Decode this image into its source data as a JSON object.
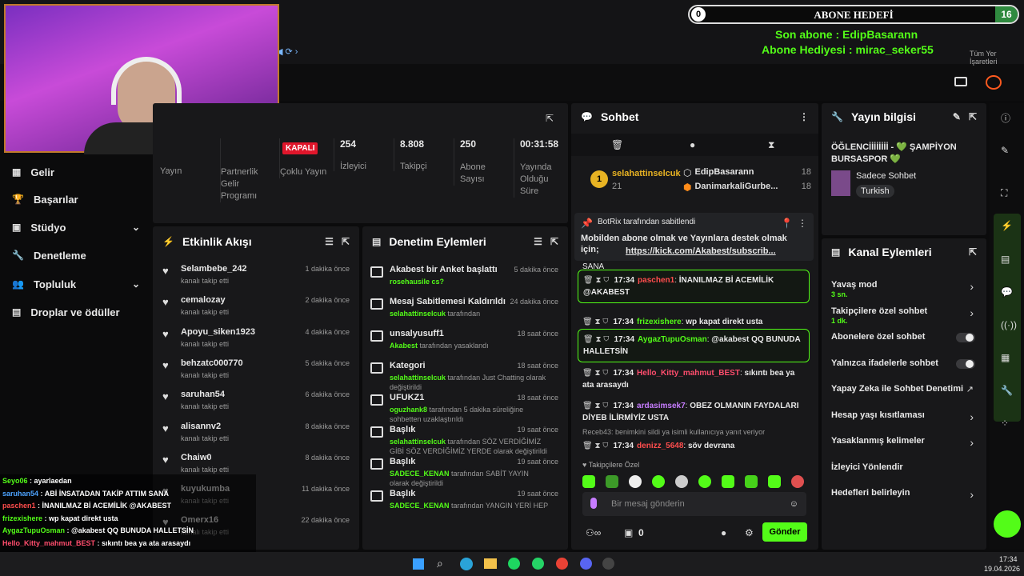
{
  "overlay": {
    "goal_title": "ABONE HEDEFİ",
    "goal_left": "0",
    "goal_right": "16",
    "last_sub": "Son abone : EdipBasarann",
    "gift_sub": "Abone Hediyesi : mirac_seker55",
    "all_bookmarks": "Tüm Yer İşaretleri"
  },
  "stats": {
    "badge": "KAPALI",
    "items": [
      {
        "value": "",
        "label": "Yayın"
      },
      {
        "value": "",
        "label": "Partnerlik Gelir Programı"
      },
      {
        "value": "",
        "label": "Çoklu Yayın"
      },
      {
        "value": "254",
        "label": "İzleyici"
      },
      {
        "value": "8.808",
        "label": "Takipçi"
      },
      {
        "value": "250",
        "label": "Abone Sayısı"
      },
      {
        "value": "00:31:58",
        "label": "Yayında Olduğu Süre"
      }
    ]
  },
  "sidebar": {
    "items": [
      {
        "label": "Gelir",
        "icon": "dollar-icon"
      },
      {
        "label": "Başarılar",
        "icon": "trophy-icon"
      },
      {
        "label": "Stüdyo",
        "icon": "studio-icon",
        "chevron": true
      },
      {
        "label": "Denetleme",
        "icon": "wrench-icon"
      },
      {
        "label": "Topluluk",
        "icon": "community-icon",
        "chevron": true
      },
      {
        "label": "Droplar ve ödüller",
        "icon": "drops-icon"
      }
    ]
  },
  "activity": {
    "title": "Etkinlik Akışı",
    "items": [
      {
        "user": "Selambebe_242",
        "action": "kanalı takip etti",
        "time": "1 dakika önce"
      },
      {
        "user": "cemalozay",
        "action": "kanalı takip etti",
        "time": "2 dakika önce"
      },
      {
        "user": "Apoyu_siken1923",
        "action": "kanalı takip etti",
        "time": "4 dakika önce"
      },
      {
        "user": "behzatc000770",
        "action": "kanalı takip etti",
        "time": "5 dakika önce"
      },
      {
        "user": "saruhan54",
        "action": "kanalı takip etti",
        "time": "6 dakika önce"
      },
      {
        "user": "alisannv2",
        "action": "kanalı takip etti",
        "time": "8 dakika önce"
      },
      {
        "user": "Chaiw0",
        "action": "kanalı takip etti",
        "time": "8 dakika önce"
      },
      {
        "user": "kuyukumba",
        "action": "kanalı takip etti",
        "time": "11 dakika önce"
      },
      {
        "user": "Omerx16",
        "action": "kanalı takip etti",
        "time": "22 dakika önce"
      }
    ]
  },
  "moderation": {
    "title": "Denetim Eylemleri",
    "items": [
      {
        "icon": "chart-icon",
        "title": "Akabest bir Anket başlattı",
        "sub1": "rosehausile cs?",
        "sub2": "",
        "time": "5 dakika önce"
      },
      {
        "icon": "unpin-icon",
        "title": "Mesaj Sabitlemesi Kaldırıldı",
        "sub1": "selahattinselcuk",
        "sub2": "tarafından",
        "time": "24 dakika önce"
      },
      {
        "icon": "ban-icon",
        "title": "unsalyusuff1",
        "sub1": "Akabest",
        "sub2": "tarafından yasaklandı",
        "time": "18 saat önce"
      },
      {
        "icon": "category-icon",
        "title": "Kategori",
        "sub1": "selahattinselcuk",
        "sub2": "tarafından Just Chatting olarak değiştirildi",
        "time": "18 saat önce"
      },
      {
        "icon": "hourglass-icon",
        "title": "UFUKZ1",
        "sub1": "oguzhank8",
        "sub2": "tarafından 5 dakika süreliğine sohbetten uzaklaştırıldı",
        "time": "18 saat önce"
      },
      {
        "icon": "title-icon",
        "title": "Başlık",
        "sub1": "selahattinselcuk",
        "sub2": "tarafından SÖZ VERDİĞİMİZ GİBİ SÖZ VERDİĞİMİZ YERDE olarak değiştirildi",
        "time": "19 saat önce"
      },
      {
        "icon": "title-icon",
        "title": "Başlık",
        "sub1": "SADECE_KENAN",
        "sub2": "tarafından SABİT YAYIN olarak değiştirildi",
        "time": "19 saat önce"
      },
      {
        "icon": "title-icon",
        "title": "Başlık",
        "sub1": "SADECE_KENAN",
        "sub2": "tarafından YANGIN YERİ HEP",
        "time": "19 saat önce"
      }
    ]
  },
  "chat": {
    "title": "Sohbet",
    "top1": {
      "user": "selahattinselcuk",
      "count": "21"
    },
    "top2": [
      {
        "user": "EdipBasarann",
        "count": "18"
      },
      {
        "user": "DanimarkaliGurbe...",
        "count": "18"
      }
    ],
    "pinned_by": "BotRix tarafından sabitlendi",
    "pinned_text": "Mobilden abone olmak ve Yayınlara destek olmak için;",
    "pinned_link": "https://kick.com/Akabest/subscrib...",
    "sana": "SANA",
    "messages": [
      {
        "time": "17:34",
        "user": "paschen1",
        "text": "İNANILMAZ Bİ ACEMİLİK @AKABEST",
        "color": "#ff4d4d",
        "hl": true
      },
      {
        "time": "17:34",
        "user": "frizexishere",
        "text": "wp kapat direkt usta",
        "color": "#53fc18",
        "hl": false
      },
      {
        "time": "17:34",
        "user": "AygazTupuOsman",
        "text": "@akabest QQ BUNUDA HALLETSİN",
        "color": "#53fc18",
        "hl": true
      },
      {
        "time": "17:34",
        "user": "Hello_Kitty_mahmut_BEST",
        "text": "sıkıntı bea ya ata arasaydı",
        "color": "#ff4d6d",
        "hl": false
      },
      {
        "time": "17:34",
        "user": "ardasimsek7",
        "text": "OBEZ OLMANIN FAYDALARI DİYEB İLİRMİYİZ USTA",
        "color": "#c77dff",
        "hl": false
      },
      {
        "time": "17:34",
        "user": "denizz_5648",
        "text": "söv devrana",
        "color": "#ff4d4d",
        "hl": false
      }
    ],
    "reply_note": "Receb43: benimkini sildi ya isimli kullanıcıya yanıt veriyor",
    "followers_only": "Takipçilere Özel",
    "placeholder": "Bir mesaj gönderin",
    "viewers": "0",
    "send": "Gönder"
  },
  "stream_info": {
    "title": "Yayın bilgisi",
    "stream_title": "ÖĞLENCİİİİİİİİ - 💚 ŞAMPİYON BURSASPOR 💚",
    "category": "Sadece Sohbet",
    "tag": "Turkish"
  },
  "channel_actions": {
    "title": "Kanal Eylemleri",
    "items": [
      {
        "label": "Yavaş mod",
        "sub": "3 sn.",
        "kind": "chevron"
      },
      {
        "label": "Takipçilere özel sohbet",
        "sub": "1 dk.",
        "kind": "chevron"
      },
      {
        "label": "Abonelere özel sohbet",
        "sub": "",
        "kind": "toggle"
      },
      {
        "label": "Yalnızca ifadelerle sohbet",
        "sub": "",
        "kind": "toggle"
      },
      {
        "label": "Yapay Zeka ile Sohbet Denetimi",
        "sub": "",
        "kind": "external"
      },
      {
        "label": "Hesap yaşı kısıtlaması",
        "sub": "",
        "kind": "chevron"
      },
      {
        "label": "Yasaklanmış kelimeler",
        "sub": "",
        "kind": "chevron"
      },
      {
        "label": "İzleyici Yönlendir",
        "sub": "",
        "kind": "none"
      },
      {
        "label": "Hedefleri belirleyin",
        "sub": "",
        "kind": "chevron"
      }
    ]
  },
  "overlay_chat": [
    {
      "user": "Seyo06",
      "text": "ayarlaedan",
      "color": "#53fc18"
    },
    {
      "user": "saruhan54",
      "text": "ABİ İNSATADAN TAKİP ATTIM SANA",
      "color": "#4da3ff"
    },
    {
      "user": "paschen1",
      "text": "İNANILMAZ Bİ ACEMİLİK @AKABEST",
      "color": "#ff4d4d"
    },
    {
      "user": "frizexishere",
      "text": "wp kapat direkt usta",
      "color": "#53fc18"
    },
    {
      "user": "AygazTupuOsman",
      "text": "@akabest QQ BUNUDA HALLETSİN",
      "color": "#53fc18"
    },
    {
      "user": "Hello_Kitty_mahmut_BEST",
      "text": "sıkıntı bea ya ata arasaydı",
      "color": "#ff4d6d"
    },
    {
      "user": "ardasimsek7",
      "text": "OBEZ OLMANIN FAYDALARI DİYEB İLİRMİYİZ USTA",
      "color": "#c77dff"
    },
    {
      "user": "denizz_5648",
      "text": "söv devrana",
      "color": "#ff4d4d"
    }
  ],
  "taskbar": {
    "time": "17:34",
    "date": "19.04.2026"
  },
  "colors": {
    "accent": "#53fc18",
    "panel": "#18181a",
    "bg": "#0b0b0c"
  }
}
